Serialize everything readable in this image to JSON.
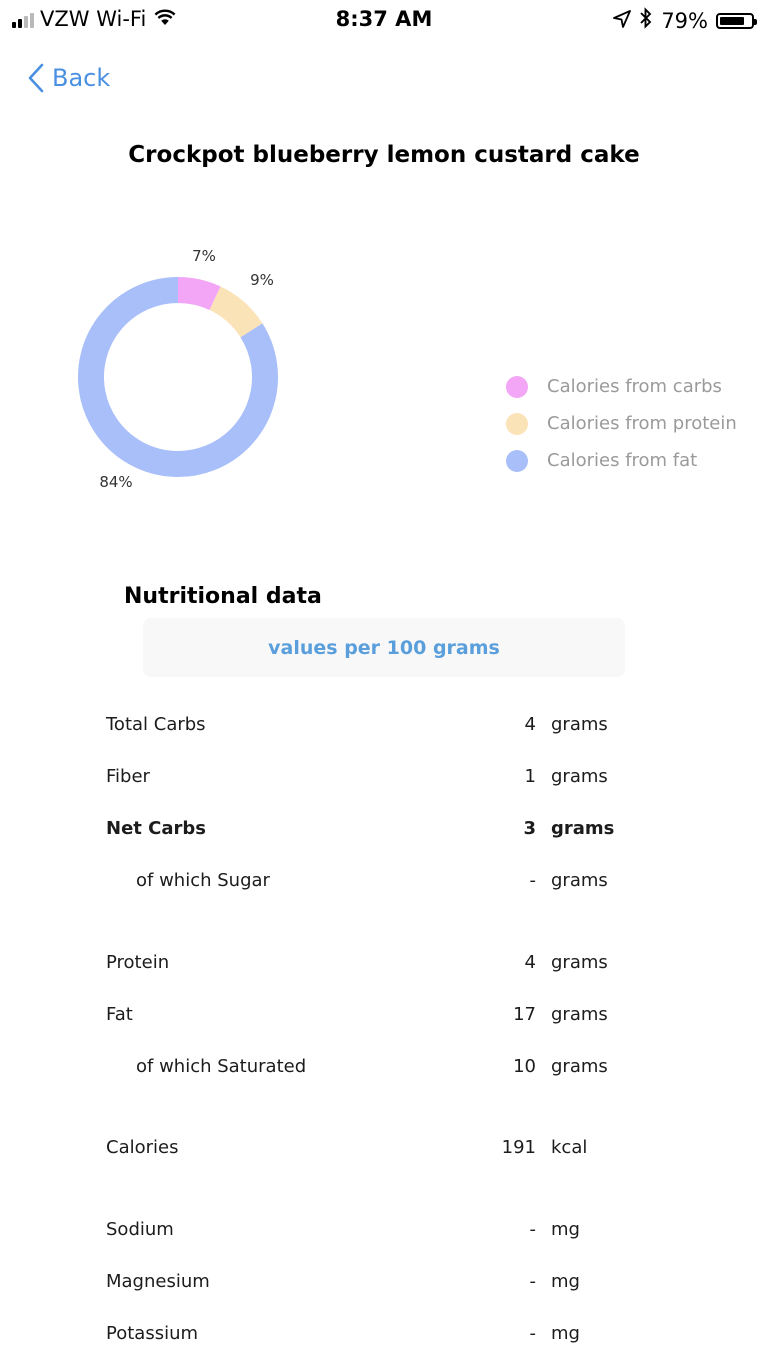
{
  "status_bar": {
    "carrier": "VZW Wi-Fi",
    "time": "8:37 AM",
    "battery": "79%",
    "battery_level": 0.79,
    "signal_bars": 2,
    "icons": [
      "signal-icon",
      "wifi-icon",
      "location-arrow-icon",
      "bluetooth-icon",
      "battery-icon"
    ]
  },
  "nav": {
    "back_label": "Back"
  },
  "recipe_title": "Crockpot blueberry lemon custard cake",
  "chart_data": {
    "type": "pie",
    "donut": true,
    "slices": [
      {
        "name": "Calories from carbs",
        "value": 7,
        "label": "7%",
        "color": "#f2a6f5"
      },
      {
        "name": "Calories from protein",
        "value": 9,
        "label": "9%",
        "color": "#fbe3b8"
      },
      {
        "name": "Calories from fat",
        "value": 84,
        "label": "84%",
        "color": "#a9bffa"
      }
    ],
    "legend_position": "right"
  },
  "nutrition": {
    "title": "Nutritional data",
    "per_label": "values per 100 grams",
    "rows": [
      {
        "label": "Total Carbs",
        "value": "4",
        "unit": "grams"
      },
      {
        "label": "Fiber",
        "value": "1",
        "unit": "grams"
      },
      {
        "label": "Net Carbs",
        "value": "3",
        "unit": "grams"
      },
      {
        "label": "of which Sugar",
        "value": "-",
        "unit": "grams"
      },
      {
        "label": "Protein",
        "value": "4",
        "unit": "grams"
      },
      {
        "label": "Fat",
        "value": "17",
        "unit": "grams"
      },
      {
        "label": "of which Saturated",
        "value": "10",
        "unit": "grams"
      },
      {
        "label": "Calories",
        "value": "191",
        "unit": "kcal"
      },
      {
        "label": "Sodium",
        "value": "-",
        "unit": "mg"
      },
      {
        "label": "Magnesium",
        "value": "-",
        "unit": "mg"
      },
      {
        "label": "Potassium",
        "value": "-",
        "unit": "mg"
      }
    ]
  }
}
